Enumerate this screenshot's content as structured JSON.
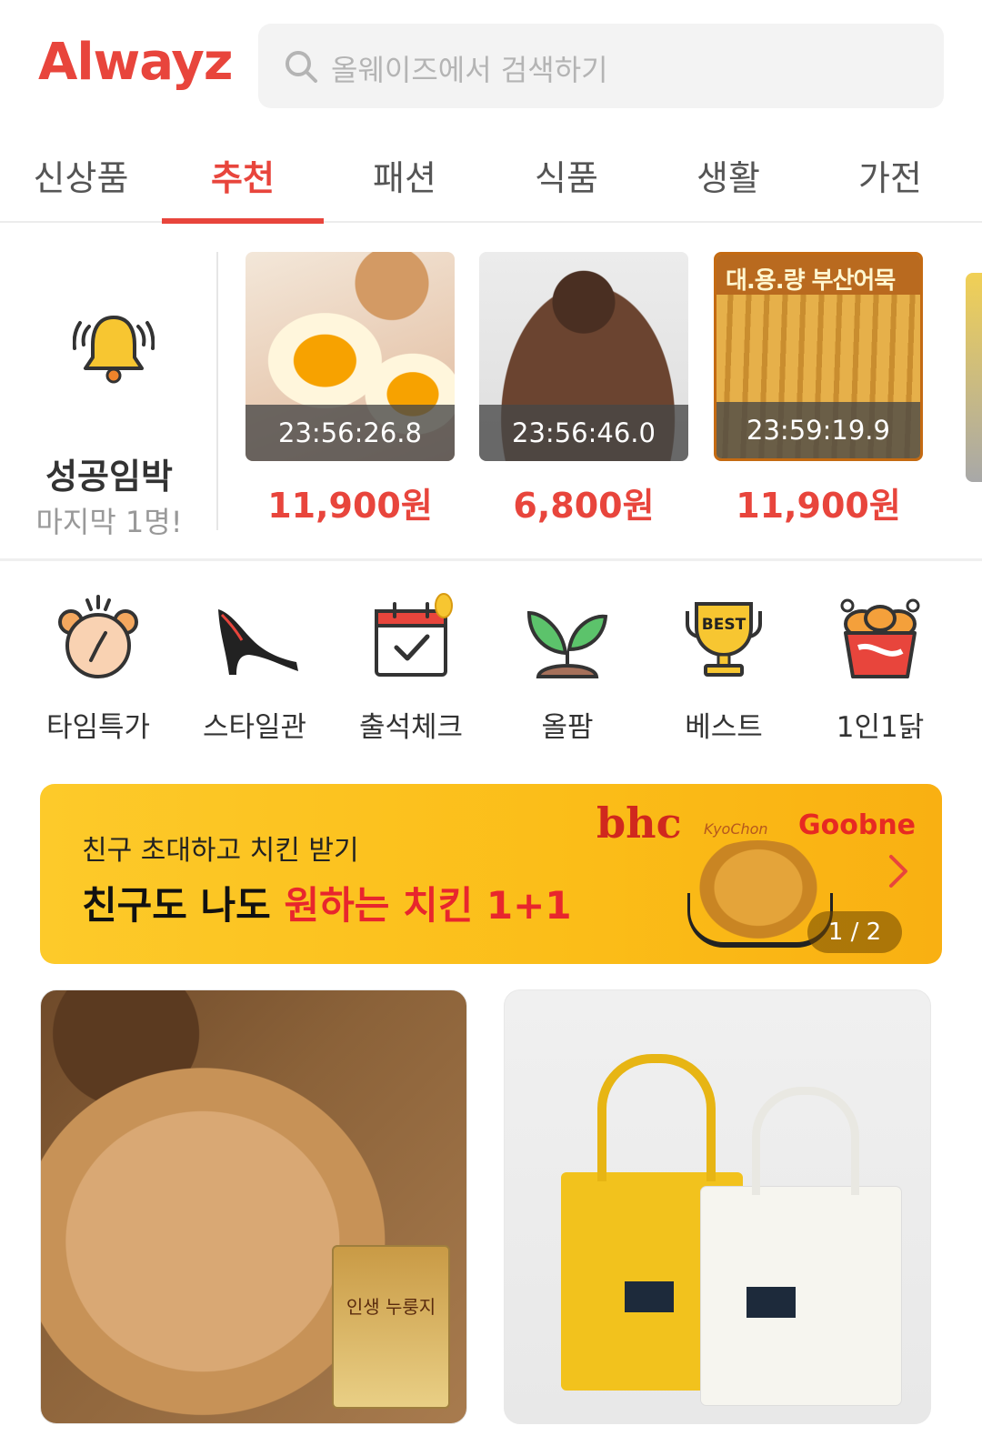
{
  "header": {
    "logo": "Alwayz",
    "search_placeholder": "올웨이즈에서 검색하기"
  },
  "tabs": [
    {
      "label": "신상품",
      "active": false
    },
    {
      "label": "추천",
      "active": true
    },
    {
      "label": "패션",
      "active": false
    },
    {
      "label": "식품",
      "active": false
    },
    {
      "label": "생활",
      "active": false
    },
    {
      "label": "가전",
      "active": false
    }
  ],
  "deal_alert": {
    "icon": "bell-icon",
    "title": "성공임박",
    "subtitle": "마지막 1명!"
  },
  "deals": [
    {
      "timer": "23:56:26.8",
      "price": "11,900원",
      "image": "boiled-egg-image"
    },
    {
      "timer": "23:56:46.0",
      "price": "6,800원",
      "image": "hair-clip-image"
    },
    {
      "timer": "23:59:19.9",
      "price": "11,900원",
      "image": "fish-cake-image",
      "label": "대.용.량 부산어묵"
    }
  ],
  "categories": [
    {
      "label": "타임특가",
      "icon": "alarm-clock-icon"
    },
    {
      "label": "스타일관",
      "icon": "high-heel-icon"
    },
    {
      "label": "출석체크",
      "icon": "calendar-check-icon"
    },
    {
      "label": "올팜",
      "icon": "sprout-icon"
    },
    {
      "label": "베스트",
      "icon": "trophy-icon",
      "badge": "BEST"
    },
    {
      "label": "1인1닭",
      "icon": "chicken-bucket-icon"
    }
  ],
  "banner": {
    "subtitle": "친구 초대하고 치킨 받기",
    "title_prefix": "친구도 나도 ",
    "title_highlight": "원하는 치킨 1+1",
    "brands": [
      "bhc",
      "KyoChon",
      "Goobne"
    ],
    "pager": "1 / 2"
  },
  "products": [
    {
      "image": "rice-crisp-image",
      "pack_label": "인생 누룽지"
    },
    {
      "image": "canvas-tote-bags-image"
    }
  ],
  "colors": {
    "accent": "#e8453c",
    "banner": "#fbbd18"
  }
}
